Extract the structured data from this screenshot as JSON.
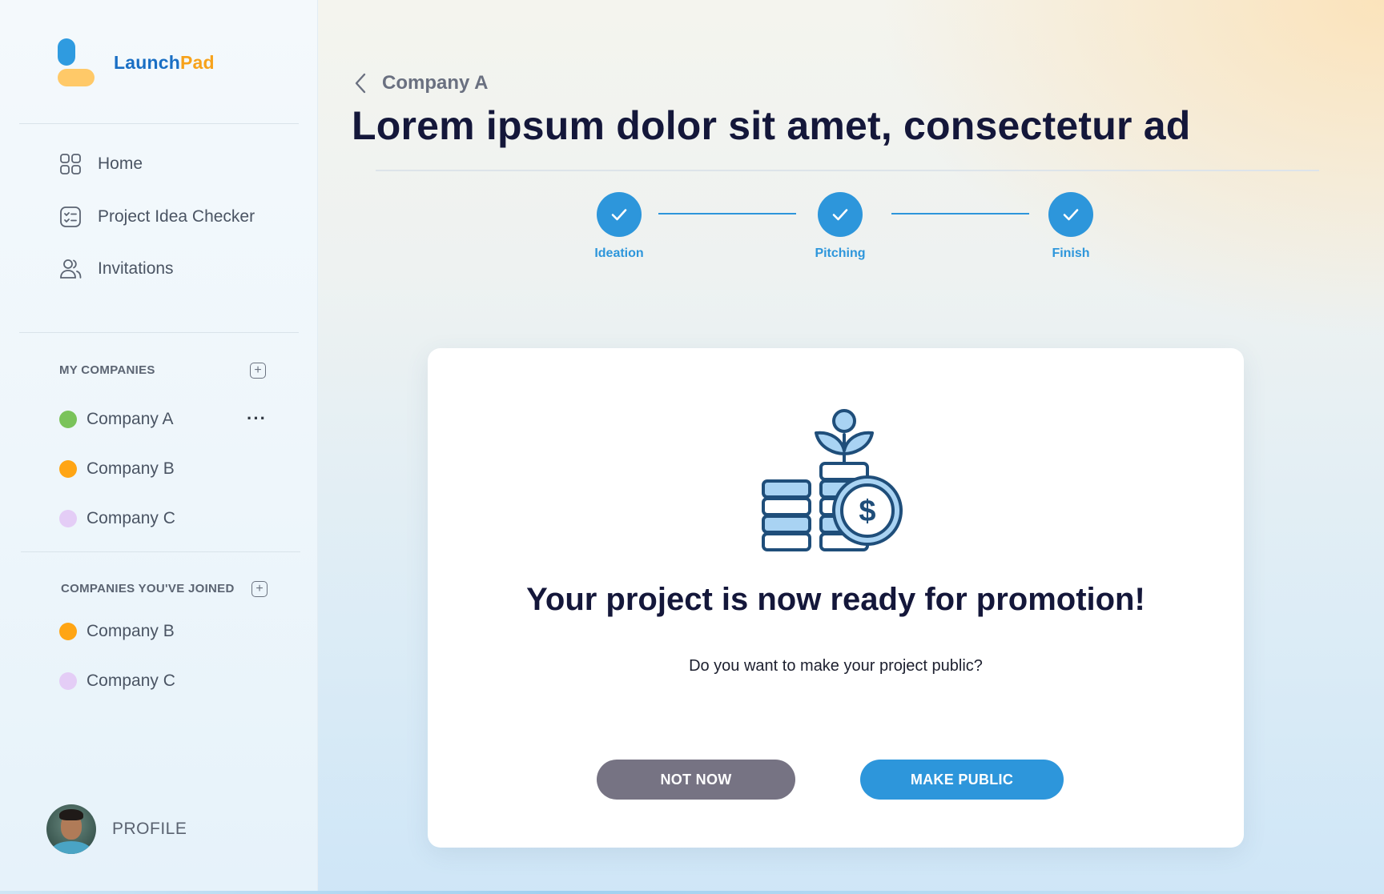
{
  "brand": {
    "name_part1": "Launch",
    "name_part2": "Pad"
  },
  "nav": [
    {
      "label": "Home",
      "icon": "grid-icon"
    },
    {
      "label": "Project Idea Checker",
      "icon": "checklist-icon"
    },
    {
      "label": "Invitations",
      "icon": "users-icon"
    }
  ],
  "my_companies": {
    "title": "MY COMPANIES",
    "items": [
      {
        "name": "Company A",
        "color": "#7ac35a"
      },
      {
        "name": "Company B",
        "color": "#ffa514"
      },
      {
        "name": "Company C",
        "color": "#e4cdf6"
      }
    ]
  },
  "joined_companies": {
    "title": "COMPANIES YOU'VE JOINED",
    "items": [
      {
        "name": "Company B",
        "color": "#ffa514"
      },
      {
        "name": "Company C",
        "color": "#e4cdf6"
      }
    ]
  },
  "profile": {
    "label": "PROFILE"
  },
  "breadcrumb": {
    "back_label": "Company A"
  },
  "page_title": "Lorem ipsum dolor sit amet, consectetur ad",
  "steps": [
    {
      "label": "Ideation",
      "status": "complete"
    },
    {
      "label": "Pitching",
      "status": "complete"
    },
    {
      "label": "Finish",
      "status": "complete"
    }
  ],
  "card": {
    "heading": "Your project is now ready for promotion!",
    "subtext": "Do you want to make your project public?",
    "secondary_button": "NOT NOW",
    "primary_button": "MAKE PUBLIC"
  },
  "colors": {
    "accent": "#2d96db",
    "brand_blue": "#1a6fc4",
    "brand_orange": "#f7a21b",
    "heading": "#14173a",
    "secondary_button": "#767383"
  }
}
